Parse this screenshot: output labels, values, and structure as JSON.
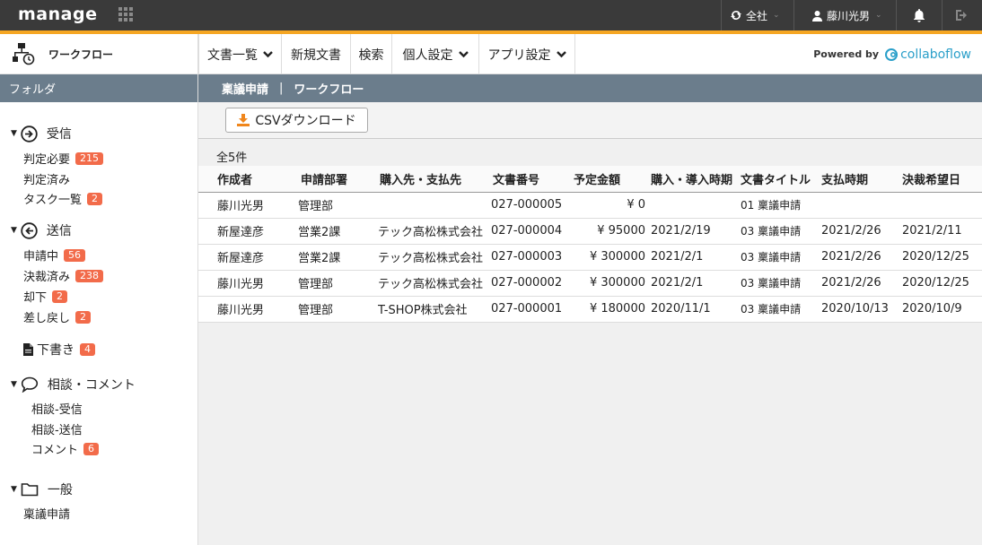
{
  "topbar": {
    "logo": "manage",
    "org_label": "全社",
    "user_label": "藤川光男"
  },
  "sidebar": {
    "app_title": "ワークフロー",
    "folder_header": "フォルダ",
    "sections": {
      "inbox": {
        "label": "受信",
        "items": [
          {
            "label": "判定必要",
            "badge": "215"
          },
          {
            "label": "判定済み",
            "badge": ""
          },
          {
            "label": "タスク一覧",
            "badge": "2"
          }
        ]
      },
      "outbox": {
        "label": "送信",
        "items": [
          {
            "label": "申請中",
            "badge": "56"
          },
          {
            "label": "決裁済み",
            "badge": "238"
          },
          {
            "label": "却下",
            "badge": "2"
          },
          {
            "label": "差し戻し",
            "badge": "2"
          }
        ]
      },
      "drafts": {
        "label": "下書き",
        "badge": "4"
      },
      "consult": {
        "label": "相談・コメント",
        "items": [
          {
            "label": "相談-受信",
            "badge": ""
          },
          {
            "label": "相談-送信",
            "badge": ""
          },
          {
            "label": "コメント",
            "badge": "6"
          }
        ]
      },
      "general": {
        "label": "一般",
        "items": [
          {
            "label": "稟議申請",
            "badge": ""
          }
        ]
      }
    }
  },
  "menu": {
    "doc_list": "文書一覧",
    "new_doc": "新規文書",
    "search": "検索",
    "personal_settings": "個人設定",
    "app_settings": "アプリ設定",
    "powered_by": "Powered by",
    "brand": "collaboflow"
  },
  "breadcrumb": {
    "current": "稟議申請",
    "separator": "|",
    "parent": "ワークフロー"
  },
  "toolbar": {
    "csv_label": "CSVダウンロード"
  },
  "table": {
    "count_label": "全5件",
    "columns": [
      "作成者",
      "申請部署",
      "購入先・支払先",
      "文書番号",
      "予定金額",
      "購入・導入時期",
      "文書タイトル",
      "支払時期",
      "決裁希望日"
    ],
    "rows": [
      [
        "藤川光男",
        "管理部",
        "",
        "027-000005",
        "¥ 0",
        "",
        "01 稟議申請",
        "",
        ""
      ],
      [
        "新屋達彦",
        "営業2課",
        "テック高松株式会社",
        "027-000004",
        "¥ 95000",
        "2021/2/19",
        "03 稟議申請",
        "2021/2/26",
        "2021/2/11"
      ],
      [
        "新屋達彦",
        "営業2課",
        "テック高松株式会社",
        "027-000003",
        "¥ 300000",
        "2021/2/1",
        "03 稟議申請",
        "2021/2/26",
        "2020/12/25"
      ],
      [
        "藤川光男",
        "管理部",
        "テック高松株式会社",
        "027-000002",
        "¥ 300000",
        "2021/2/1",
        "03 稟議申請",
        "2021/2/26",
        "2020/12/25"
      ],
      [
        "藤川光男",
        "管理部",
        "T-SHOP株式会社",
        "027-000001",
        "¥ 180000",
        "2020/11/1",
        "03 稟議申請",
        "2020/10/13",
        "2020/10/9"
      ]
    ]
  },
  "colors": {
    "topbar": "#3a3a3a",
    "accent": "#f5a623",
    "header_slate": "#6b7d8c",
    "badge": "#f26b4a",
    "brand": "#2a9fc9"
  }
}
